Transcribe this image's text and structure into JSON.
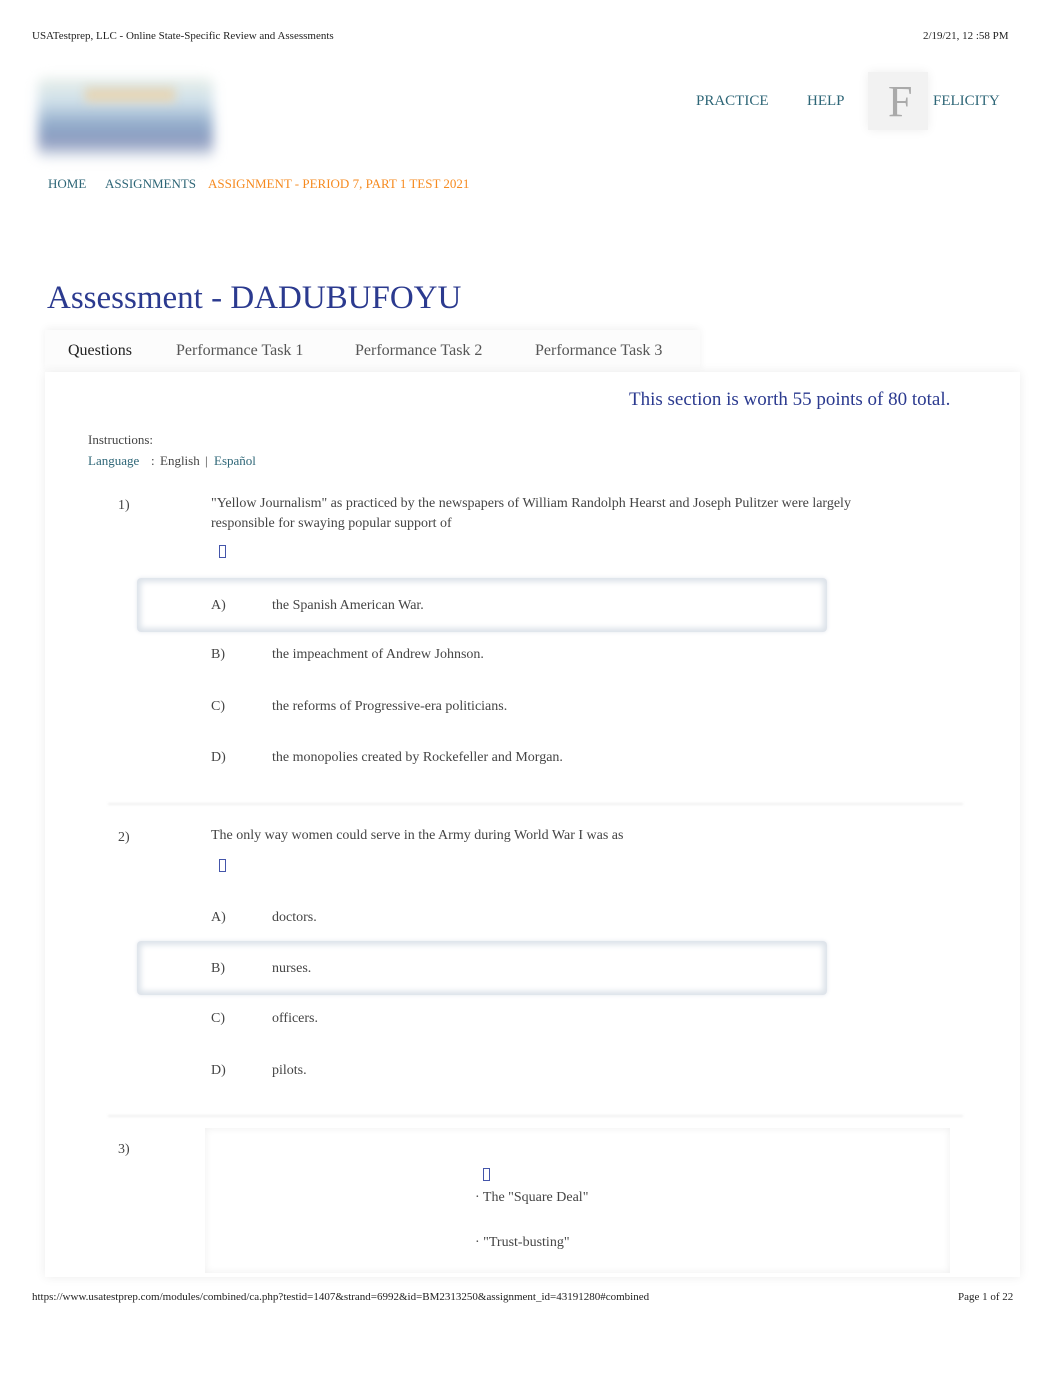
{
  "print_header": {
    "title": "USATestprep, LLC - Online State-Specific Review and Assessments",
    "datetime": "2/19/21, 12  :58 PM"
  },
  "nav": {
    "practice": "PRACTICE",
    "help": "HELP",
    "avatar_initial": "F",
    "user": "FELICITY"
  },
  "breadcrumb": {
    "home": "HOME",
    "assignments": "ASSIGNMENTS",
    "current": "ASSIGNMENT - PERIOD 7, PART 1 TEST 2021"
  },
  "page_title": "Assessment - DADUBUFOYU",
  "tabs": [
    "Questions",
    "Performance Task 1",
    "Performance Task 2",
    "Performance Task 3"
  ],
  "section_worth": "This section is worth 55 points of 80 total.",
  "instructions": {
    "label": "Instructions:",
    "language_link": "Language",
    "language_sep": ":",
    "english": "English",
    "pipe": "|",
    "espanol": "Español"
  },
  "questions": [
    {
      "number": "1)",
      "text_line1": "\"Yellow Journalism\" as practiced by the newspapers of William Randolph Hearst and Joseph Pulitzer were largely",
      "text_line2": "responsible for swaying popular support of",
      "icon": "audio-icon",
      "answers": [
        {
          "letter": "A)",
          "text": "the Spanish American War.",
          "selected": true
        },
        {
          "letter": "B)",
          "text": "the impeachment of Andrew Johnson."
        },
        {
          "letter": "C)",
          "text": "the reforms of Progressive-era politicians."
        },
        {
          "letter": "D)",
          "text": "the monopolies created by Rockefeller and Morgan."
        }
      ]
    },
    {
      "number": "2)",
      "text_line1": "The only way women could serve in the Army during World War I was as",
      "icon": "audio-icon",
      "answers": [
        {
          "letter": "A)",
          "text": "doctors."
        },
        {
          "letter": "B)",
          "text": "nurses.",
          "selected": true
        },
        {
          "letter": "C)",
          "text": "officers."
        },
        {
          "letter": "D)",
          "text": "pilots."
        }
      ]
    },
    {
      "number": "3)",
      "icon": "audio-icon",
      "bullets": [
        "· The \"Square Deal\"",
        "· \"Trust-busting\""
      ]
    }
  ],
  "print_footer": {
    "url": "https://www.usatestprep.com/modules/combined/ca.php?testid=1407&strand=6992&id=BM2313250&assignment_id=43191280#combined",
    "page": "Page 1 of 22"
  }
}
